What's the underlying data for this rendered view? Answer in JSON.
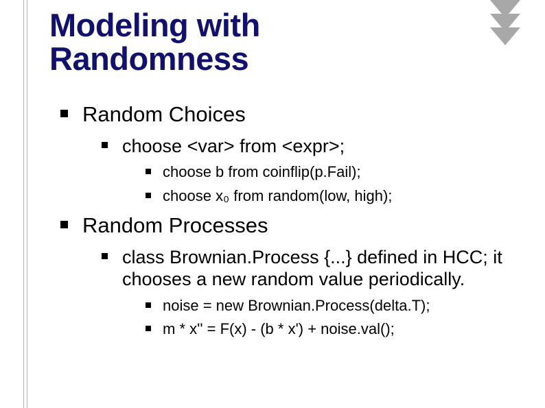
{
  "title_line1": "Modeling with",
  "title_line2": "Randomness",
  "sections": [
    {
      "heading": "Random Choices",
      "sub": [
        {
          "text": "choose <var> from <expr>;",
          "items": [
            "choose b from coinflip(p.Fail);",
            "choose x₀ from random(low, high);"
          ]
        }
      ]
    },
    {
      "heading": "Random Processes",
      "sub": [
        {
          "text": "class Brownian.Process {...} defined in HCC; it chooses a new random value periodically.",
          "items": [
            "noise = new Brownian.Process(delta.T);",
            "m * x'' = F(x) - (b * x') + noise.val();"
          ]
        }
      ]
    }
  ]
}
